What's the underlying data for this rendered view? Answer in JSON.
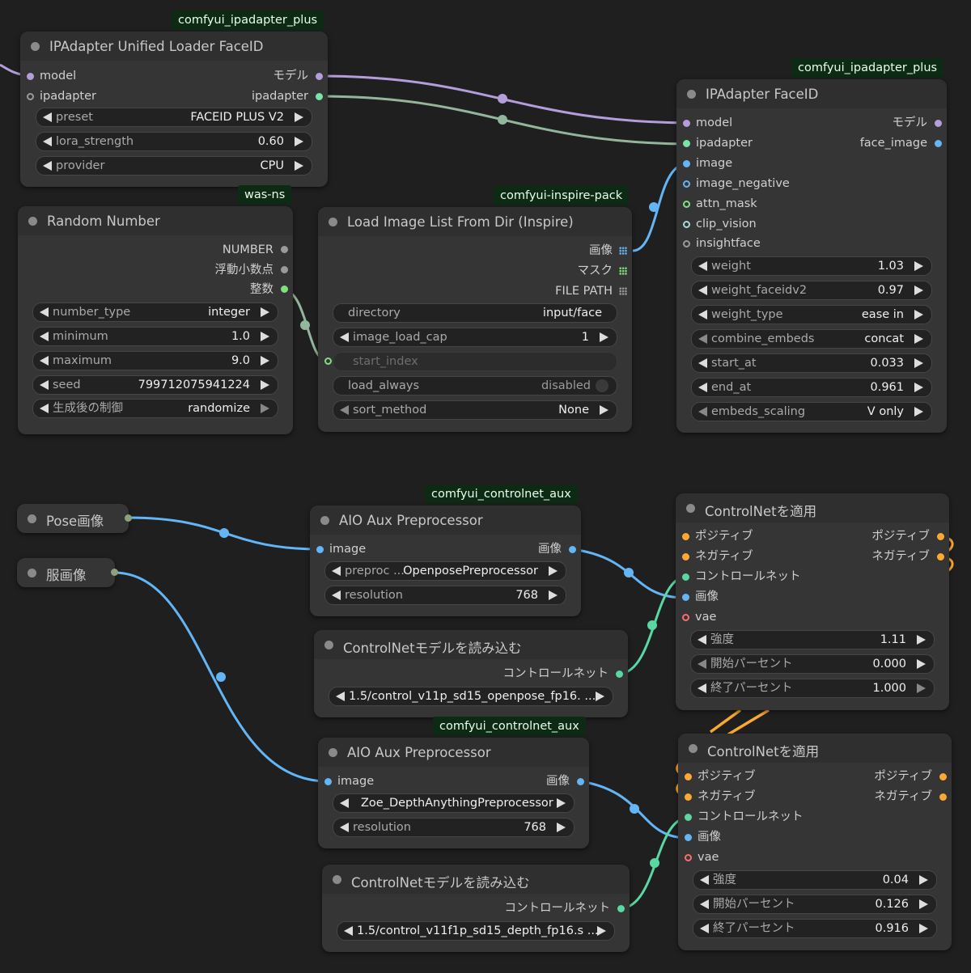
{
  "colors": {
    "model": "#b39ddb",
    "ipadapter": "#7ee2a8",
    "image": "#64b5f6",
    "int": "#7fe07f",
    "conditioning": "#ffa931",
    "control_net": "#59d8a3",
    "vae": "#ff6e6e",
    "gray": "#9a9a9a"
  },
  "nodes": {
    "unified_loader": {
      "badge": "comfyui_ipadapter_plus",
      "title": "IPAdapter Unified Loader FaceID",
      "in_model": "model",
      "in_ipadapter": "ipadapter",
      "out_model": "モデル",
      "out_ipadapter": "ipadapter",
      "w_preset_label": "preset",
      "w_preset_value": "FACEID PLUS V2",
      "w_lora_label": "lora_strength",
      "w_lora_value": "0.60",
      "w_provider_label": "provider",
      "w_provider_value": "CPU"
    },
    "random_number": {
      "badge": "was-ns",
      "title": "Random Number",
      "out_number": "NUMBER",
      "out_float": "浮動小数点",
      "out_int": "整数",
      "w_type_label": "number_type",
      "w_type_value": "integer",
      "w_min_label": "minimum",
      "w_min_value": "1.0",
      "w_max_label": "maximum",
      "w_max_value": "9.0",
      "w_seed_label": "seed",
      "w_seed_value": "799712075941224",
      "w_ctrl_label": "生成後の制御",
      "w_ctrl_value": "randomize"
    },
    "load_image_list": {
      "badge": "comfyui-inspire-pack",
      "title": "Load Image List From Dir (Inspire)",
      "out_image": "画像",
      "out_mask": "マスク",
      "out_filepath": "FILE PATH",
      "w_dir_label": "directory",
      "w_dir_value": "input/face",
      "w_cap_label": "image_load_cap",
      "w_cap_value": "1",
      "w_start_label": "start_index",
      "w_load_label": "load_always",
      "w_load_value": "disabled",
      "w_sort_label": "sort_method",
      "w_sort_value": "None"
    },
    "ipadapter_faceid": {
      "badge": "comfyui_ipadapter_plus",
      "title": "IPAdapter FaceID",
      "in_model": "model",
      "in_ipadapter": "ipadapter",
      "in_image": "image",
      "in_image_negative": "image_negative",
      "in_attn_mask": "attn_mask",
      "in_clip_vision": "clip_vision",
      "in_insightface": "insightface",
      "out_model": "モデル",
      "out_face_image": "face_image",
      "w_weight_label": "weight",
      "w_weight_value": "1.03",
      "w_weightv2_label": "weight_faceidv2",
      "w_weightv2_value": "0.97",
      "w_wtype_label": "weight_type",
      "w_wtype_value": "ease in",
      "w_combine_label": "combine_embeds",
      "w_combine_value": "concat",
      "w_start_label": "start_at",
      "w_start_value": "0.033",
      "w_end_label": "end_at",
      "w_end_value": "0.961",
      "w_scaling_label": "embeds_scaling",
      "w_scaling_value": "V only"
    },
    "pose_image": {
      "title": "Pose画像"
    },
    "clothes_image": {
      "title": "服画像"
    },
    "aio_aux_1": {
      "badge": "comfyui_controlnet_aux",
      "title": "AIO Aux Preprocessor",
      "in_image": "image",
      "out_image": "画像",
      "w_pre_label": "preproc ...",
      "w_pre_value": "OpenposePreprocessor",
      "w_res_label": "resolution",
      "w_res_value": "768"
    },
    "controlnet_loader_1": {
      "title": "ControlNetモデルを読み込む",
      "out_cn": "コントロールネット",
      "w_model_value": "1.5/control_v11p_sd15_openpose_fp16. ..."
    },
    "aio_aux_2": {
      "badge": "comfyui_controlnet_aux",
      "title": "AIO Aux Preprocessor",
      "in_image": "image",
      "out_image": "画像",
      "w_pre_value": "Zoe_DepthAnythingPreprocessor",
      "w_res_label": "resolution",
      "w_res_value": "768"
    },
    "controlnet_loader_2": {
      "title": "ControlNetモデルを読み込む",
      "out_cn": "コントロールネット",
      "w_model_value": "1.5/control_v11f1p_sd15_depth_fp16.s ..."
    },
    "apply_cn_1": {
      "title": "ControlNetを適用",
      "in_pos": "ポジティブ",
      "in_neg": "ネガティブ",
      "in_cn": "コントロールネット",
      "in_image": "画像",
      "in_vae": "vae",
      "out_pos": "ポジティブ",
      "out_neg": "ネガティブ",
      "w_str_label": "強度",
      "w_str_value": "1.11",
      "w_start_label": "開始パーセント",
      "w_start_value": "0.000",
      "w_end_label": "終了パーセント",
      "w_end_value": "1.000"
    },
    "apply_cn_2": {
      "title": "ControlNetを適用",
      "in_pos": "ポジティブ",
      "in_neg": "ネガティブ",
      "in_cn": "コントロールネット",
      "in_image": "画像",
      "in_vae": "vae",
      "out_pos": "ポジティブ",
      "out_neg": "ネガティブ",
      "w_str_label": "強度",
      "w_str_value": "0.04",
      "w_start_label": "開始パーセント",
      "w_start_value": "0.126",
      "w_end_label": "終了パーセント",
      "w_end_value": "0.916"
    }
  }
}
